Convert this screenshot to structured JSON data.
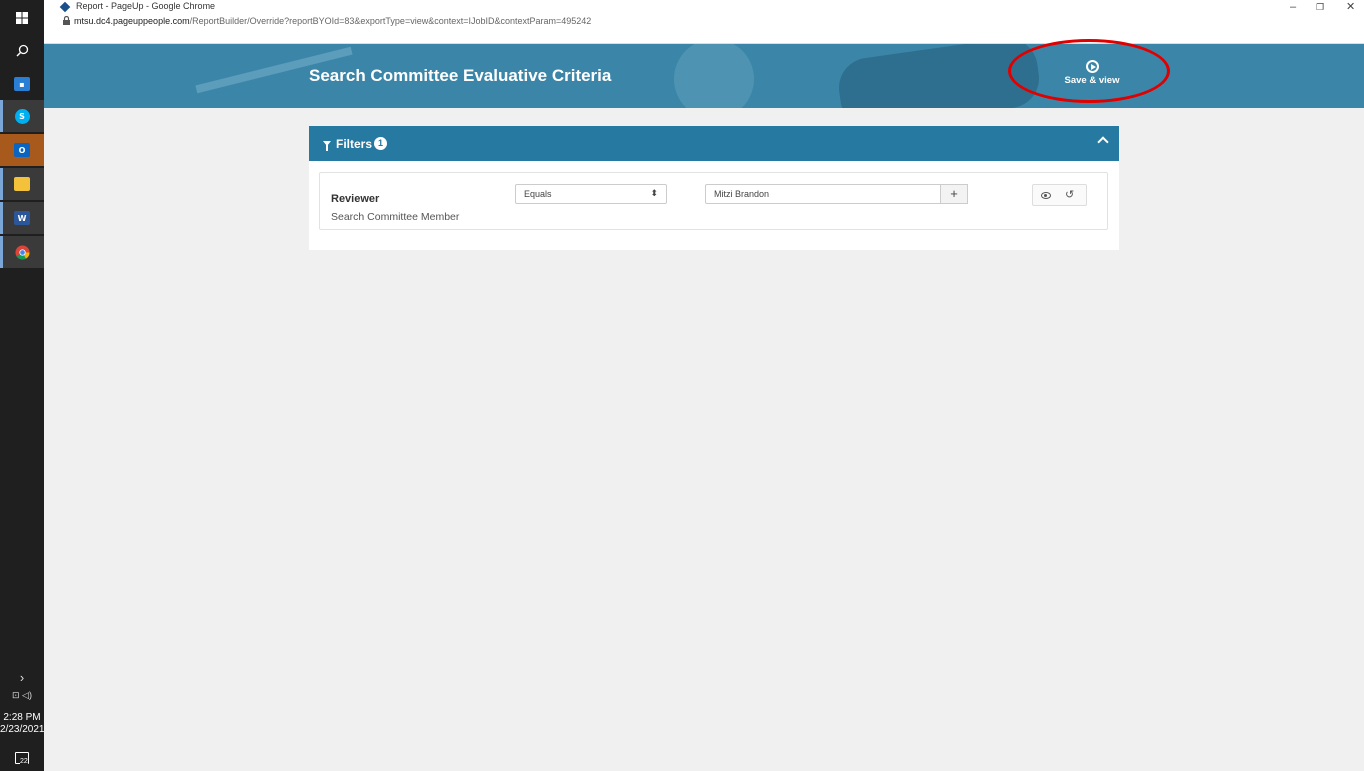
{
  "browser": {
    "window_title": "Report - PageUp - Google Chrome",
    "url_host": "mtsu.dc4.pageuppeople.com",
    "url_path": "/ReportBuilder/Override?reportBYOId=83&exportType=view&context=IJobID&contextParam=495242",
    "minimize": "–",
    "restore": "❐",
    "close": "✕"
  },
  "taskbar": {
    "time": "2:28 PM",
    "date": "2/23/2021",
    "notification_count": "22",
    "expand": "›",
    "tray": "⊡ ◁)"
  },
  "header": {
    "title": "Search Committee Evaluative Criteria",
    "save_view_label": "Save & view"
  },
  "filters": {
    "heading": "Filters",
    "count": "1",
    "rows": [
      {
        "label": "Reviewer",
        "sublabel": "Search Committee Member",
        "operator": "Equals",
        "value": "Mitzi Brandon",
        "add_symbol": "+",
        "reset_symbol": "↺"
      }
    ]
  },
  "colors": {
    "banner": "#3b86a8",
    "filters_header": "#2679a1",
    "highlight": "#e00000"
  }
}
